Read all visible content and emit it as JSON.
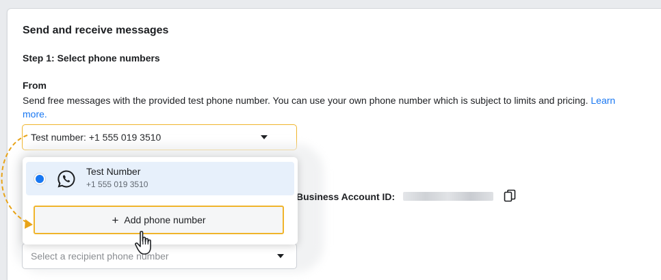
{
  "section": {
    "title": "Send and receive messages",
    "step_title": "Step 1: Select phone numbers"
  },
  "from": {
    "label": "From",
    "description": "Send free messages with the provided test phone number. You can use your own phone number which is subject to limits and pricing.",
    "learn_more": "Learn more.",
    "selected_value": "Test number: +1 555 019 3510"
  },
  "dropdown": {
    "option": {
      "name": "Test Number",
      "number": "+1 555 019 3510",
      "icon": "whatsapp-icon",
      "selected": true
    },
    "add_button": {
      "icon": "+",
      "label": "Add phone number"
    }
  },
  "business_account": {
    "label": "Business Account ID:",
    "copy_icon": "copy-icon"
  },
  "recipient": {
    "placeholder": "Select a recipient phone number"
  },
  "colors": {
    "accent": "#1877f2",
    "highlight_border": "#f0b42a",
    "selected_row": "#e7f0fb",
    "annotation_arrow": "#e8a317"
  }
}
